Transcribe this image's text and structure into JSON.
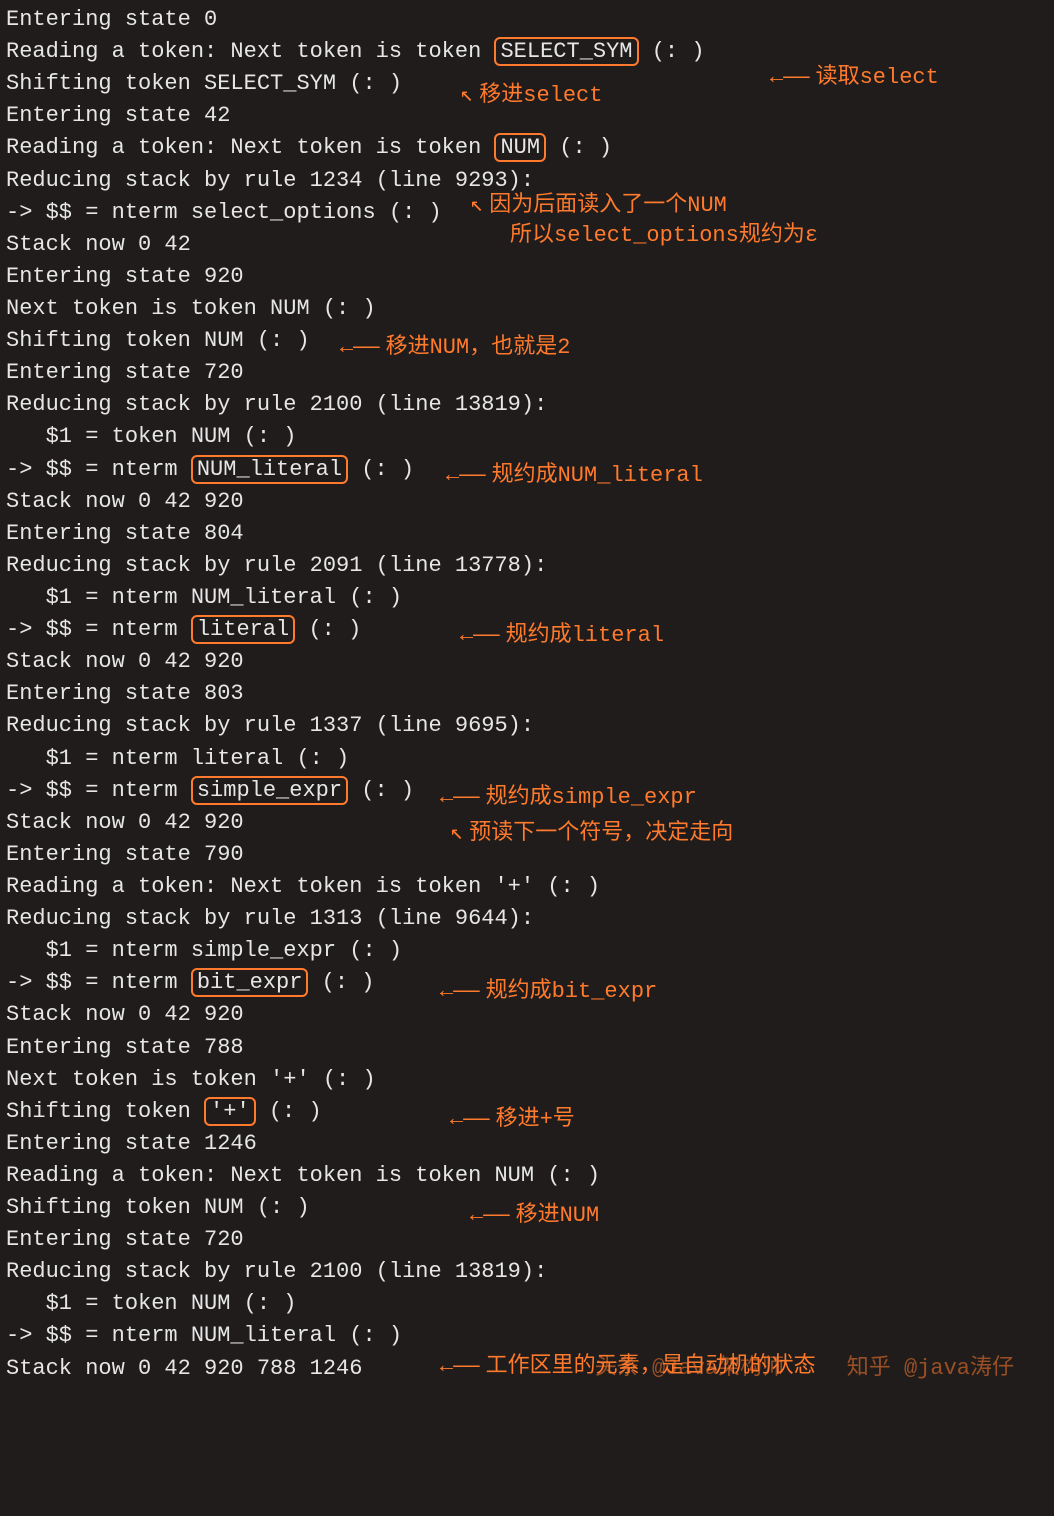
{
  "lines": {
    "l1": "Entering state 0",
    "l2a": "Reading a token: Next token is token ",
    "l2b": "SELECT_SYM",
    "l2c": "(: )",
    "l3": "Shifting token SELECT_SYM (: )",
    "l4": "Entering state 42",
    "l5a": "Reading a token: Next token is token ",
    "l5b": "NUM",
    "l5c": "(: )",
    "l6": "Reducing stack by rule 1234 (line 9293):",
    "l7": "-> $$ = nterm select_options (: )",
    "l8": "Stack now 0 42",
    "l9": "Entering state 920",
    "l10": "Next token is token NUM (: )",
    "l11": "Shifting token NUM (: )",
    "l12": "Entering state 720",
    "l13": "Reducing stack by rule 2100 (line 13819):",
    "l14": "   $1 = token NUM (: )",
    "l15a": "-> $$ = nterm ",
    "l15b": "NUM_literal",
    "l15c": "(: )",
    "l16": "Stack now 0 42 920",
    "l17": "Entering state 804",
    "l18": "Reducing stack by rule 2091 (line 13778):",
    "l19": "   $1 = nterm NUM_literal (: )",
    "l20a": "-> $$ = nterm ",
    "l20b": "literal",
    "l20c": "(: )",
    "l21": "Stack now 0 42 920",
    "l22": "Entering state 803",
    "l23": "Reducing stack by rule 1337 (line 9695):",
    "l24": "   $1 = nterm literal (: )",
    "l25a": "-> $$ = nterm ",
    "l25b": "simple_expr",
    "l25c": "(: )",
    "l26": "Stack now 0 42 920",
    "l27": "Entering state 790",
    "l28": "Reading a token: Next token is token '+' (: )",
    "l29": "Reducing stack by rule 1313 (line 9644):",
    "l30": "   $1 = nterm simple_expr (: )",
    "l31a": "-> $$ = nterm ",
    "l31b": "bit_expr",
    "l31c": "(: )",
    "l32": "Stack now 0 42 920",
    "l33": "Entering state 788",
    "l34": "Next token is token '+' (: )",
    "l35a": "Shifting token ",
    "l35b": "'+'",
    "l35c": "(: )",
    "l36": "Entering state 1246",
    "l37": "Reading a token: Next token is token NUM (: )",
    "l38": "Shifting token NUM (: )",
    "l39": "Entering state 720",
    "l40": "Reducing stack by rule 2100 (line 13819):",
    "l41": "   $1 = token NUM (: )",
    "l42": "-> $$ = nterm NUM_literal (: )",
    "l43": "Stack now 0 42 920 788 1246"
  },
  "annotations": {
    "a_read_select": "读取select",
    "a_shift_select": "移进select",
    "a_num_note1": "因为后面读入了一个NUM",
    "a_num_note2": "所以select_options规约为ε",
    "a_shift_num": "移进NUM，也就是2",
    "a_num_literal": "规约成NUM_literal",
    "a_literal": "规约成literal",
    "a_simple_expr": "规约成simple_expr",
    "a_lookahead": "预读下一个符号，决定走向",
    "a_bit_expr": "规约成bit_expr",
    "a_shift_plus": "移进+号",
    "a_shift_num2": "移进NUM",
    "a_stack": "工作区里的元素，是自动机的状态"
  },
  "watermarks": {
    "w1": "头条 @Java架构师",
    "w2": "知乎 @java涛仔"
  },
  "arrow_left": "←——",
  "arrow_diag": "↖"
}
